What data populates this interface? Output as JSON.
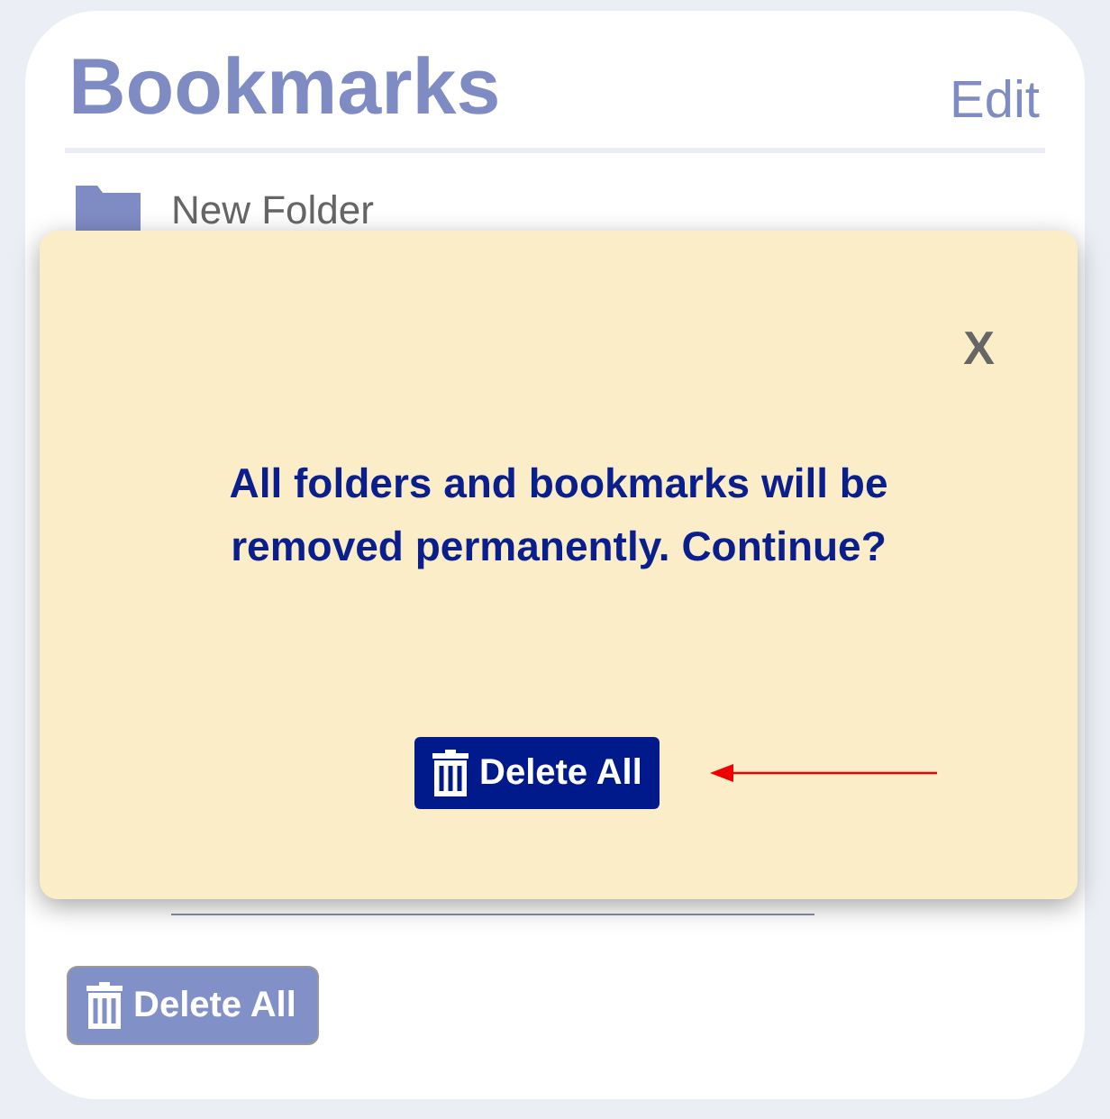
{
  "header": {
    "title": "Bookmarks",
    "edit": "Edit"
  },
  "folders": [
    {
      "name": "New Folder"
    }
  ],
  "footer": {
    "button": "Delete All"
  },
  "dialog": {
    "close": "X",
    "message": "All folders and bookmarks will be removed permanently. Continue?",
    "button": "Delete All"
  }
}
